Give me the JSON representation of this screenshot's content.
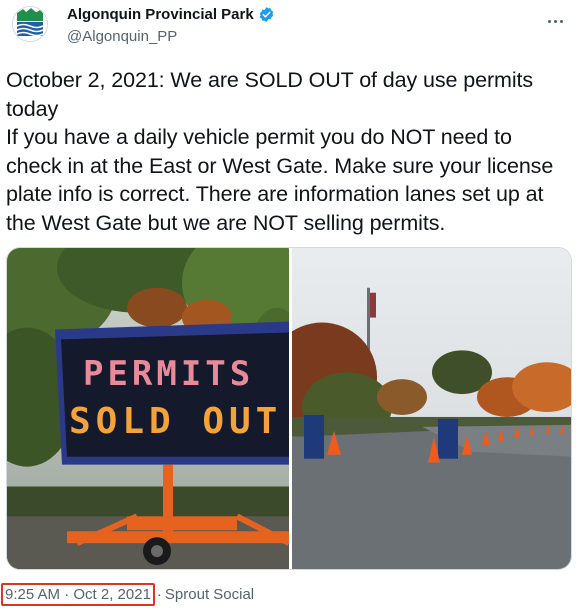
{
  "account": {
    "display_name": "Algonquin Provincial Park",
    "handle": "@Algonquin_PP",
    "avatar_icon": "park-logo-icon",
    "verified_icon": "verified-badge-icon"
  },
  "menu_icon": "more-options-icon",
  "tweet": {
    "lines": [
      "October 2, 2021: We are SOLD OUT of day use permits",
      "today",
      "If you have a daily vehicle permit you do NOT need to",
      "check in at the East or West Gate. Make sure your license",
      "plate info is correct. There are information lanes set up at",
      "the West Gate but we are NOT selling permits."
    ]
  },
  "media": {
    "sign_line_1": "PERMITS",
    "sign_line_2": "SOLD OUT"
  },
  "meta": {
    "timestamp": "9:25 AM · Oct 2, 2021",
    "separator": "·",
    "source": "Sprout Social"
  },
  "colors": {
    "text": "#0f1419",
    "secondary": "#536471",
    "verified": "#1d9bf0",
    "highlight_box": "#e0351f",
    "sign_amber": "#f4a23a",
    "sign_pink": "#e88a9a",
    "cone_orange": "#f05a1e"
  }
}
